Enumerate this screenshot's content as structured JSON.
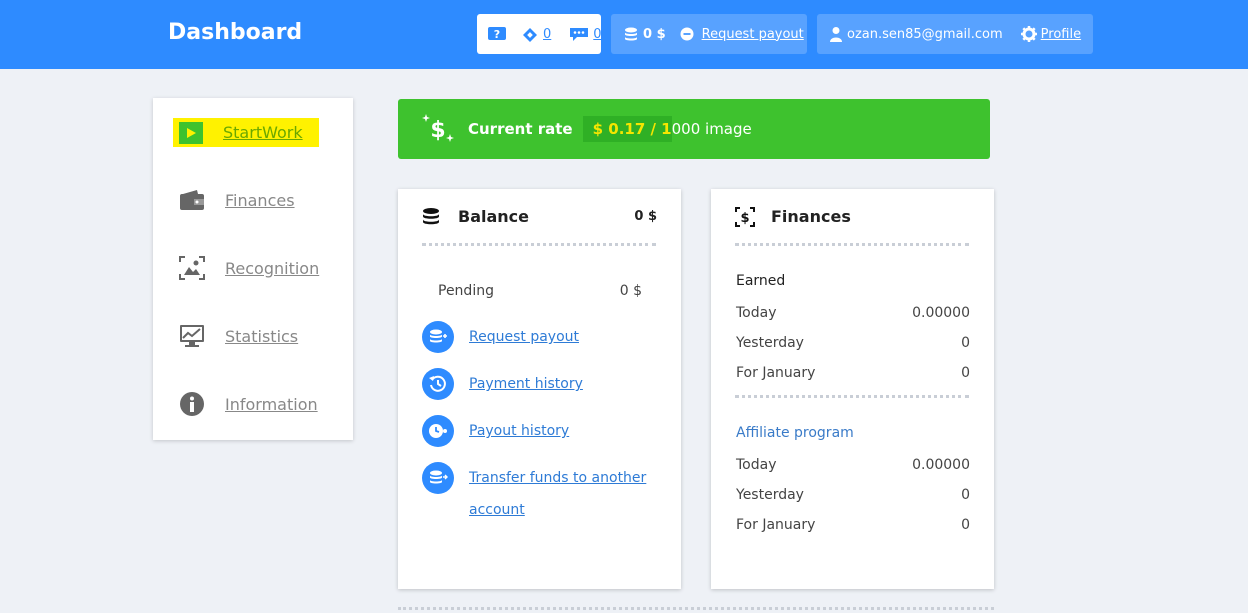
{
  "header": {
    "title": "Dashboard",
    "tickets_count": "0",
    "messages_count": "0",
    "balance": "0 $",
    "request_payout": "Request payout",
    "email": "ozan.sen85@gmail.com",
    "profile": "Profile"
  },
  "sidebar": {
    "items": [
      {
        "label": "StartWork",
        "icon": "play-icon"
      },
      {
        "label": "Finances",
        "icon": "wallet-icon"
      },
      {
        "label": "Recognition",
        "icon": "image-scan-icon"
      },
      {
        "label": "Statistics",
        "icon": "monitor-chart-icon"
      },
      {
        "label": "Information",
        "icon": "info-icon"
      }
    ]
  },
  "rate": {
    "label": "Current rate",
    "highlight": "$ 0.17 / 1",
    "rest": "000 image"
  },
  "balance_card": {
    "title": "Balance",
    "amount": "0 $",
    "pending_label": "Pending",
    "pending_value": "0 $",
    "links": [
      "Request payout",
      "Payment history",
      "Payout history",
      "Transfer funds to another account"
    ]
  },
  "finances_card": {
    "title": "Finances",
    "earned_label": "Earned",
    "earned": [
      {
        "label": "Today",
        "value": "0.00000"
      },
      {
        "label": "Yesterday",
        "value": "0"
      },
      {
        "label": "For January",
        "value": "0"
      }
    ],
    "affiliate_label": "Affiliate program",
    "affiliate": [
      {
        "label": "Today",
        "value": "0.00000"
      },
      {
        "label": "Yesterday",
        "value": "0"
      },
      {
        "label": "For January",
        "value": "0"
      }
    ]
  },
  "colors": {
    "accent": "#2e8bff",
    "rate_bg": "#3ec22e",
    "highlight": "#fff200"
  }
}
